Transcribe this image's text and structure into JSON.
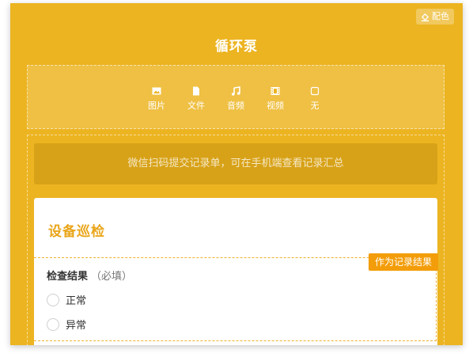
{
  "header": {
    "color_scheme_label": "配色",
    "title": "循环泵"
  },
  "media_options": [
    {
      "label": "图片",
      "icon": "image-icon"
    },
    {
      "label": "文件",
      "icon": "file-icon"
    },
    {
      "label": "音频",
      "icon": "music-icon"
    },
    {
      "label": "视频",
      "icon": "video-icon"
    },
    {
      "label": "无",
      "icon": "none-icon"
    }
  ],
  "notice": "微信扫码提交记录单，可在手机端查看记录汇总",
  "form": {
    "title": "设备巡检",
    "field": {
      "label": "检查结果",
      "required_hint": "（必填）",
      "record_tag": "作为记录结果",
      "options": [
        "正常",
        "异常"
      ]
    }
  },
  "colors": {
    "accent": "#ecb421",
    "title_text": "#e9a519",
    "tag": "#f39d0a"
  }
}
